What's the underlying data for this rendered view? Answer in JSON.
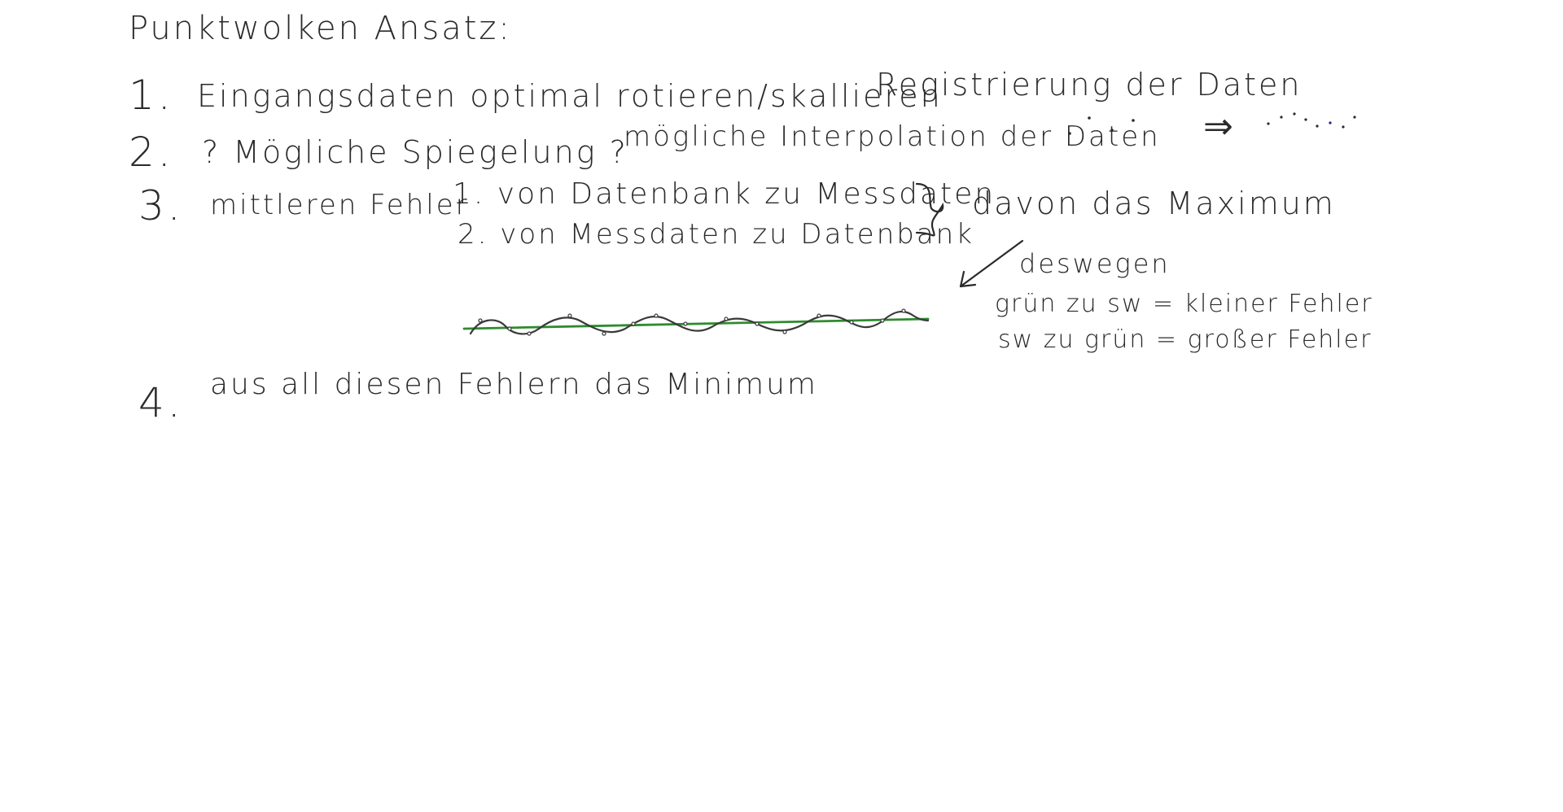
{
  "title": "Punktwolken Ansatz:",
  "items": [
    {
      "number": "1.",
      "text": "Eingangsdaten optimal rotieren/skallieren",
      "note": "Registrierung der Daten"
    },
    {
      "number": "2.",
      "text": "? Mögliche Spiegelung ?",
      "note": "mögliche Interpolation der Daten",
      "result_arrow": "⇒"
    },
    {
      "number": "3.",
      "text": "mittleren Fehler",
      "sub1": "1. von Datenbank zu Messdaten",
      "sub2": "2. von Messdaten zu Datenbank",
      "brace_note": "davon das Maximum",
      "arrow_label": "deswegen",
      "line_a": "grün zu sw = kleiner Fehler",
      "line_b": "sw zu grün = großer Fehler"
    },
    {
      "number": "4.",
      "text": "aus all diesen Fehlern das Minimum"
    }
  ],
  "colors": {
    "ink": "#2a2a2a",
    "green_line": "#2e8b2e",
    "blue_dot": "#1a237e"
  }
}
